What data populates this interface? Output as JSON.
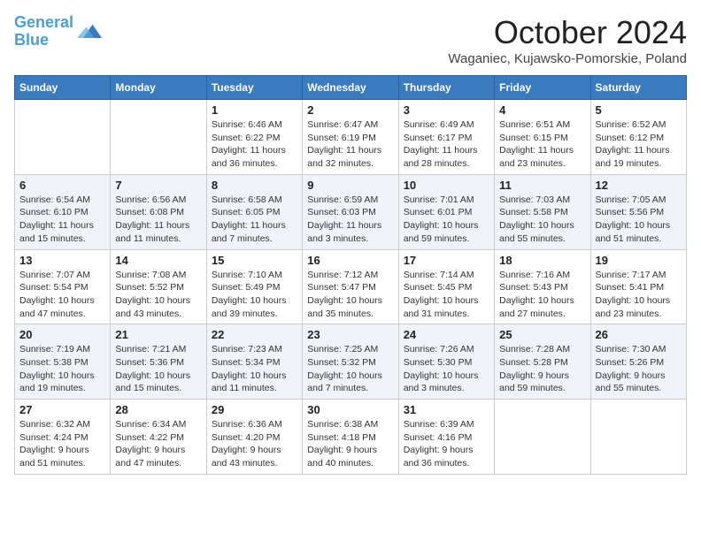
{
  "header": {
    "logo_line1": "General",
    "logo_line2": "Blue",
    "month_title": "October 2024",
    "location": "Waganiec, Kujawsko-Pomorskie, Poland"
  },
  "days_of_week": [
    "Sunday",
    "Monday",
    "Tuesday",
    "Wednesday",
    "Thursday",
    "Friday",
    "Saturday"
  ],
  "weeks": [
    [
      {
        "day": "",
        "info": ""
      },
      {
        "day": "",
        "info": ""
      },
      {
        "day": "1",
        "info": "Sunrise: 6:46 AM\nSunset: 6:22 PM\nDaylight: 11 hours and 36 minutes."
      },
      {
        "day": "2",
        "info": "Sunrise: 6:47 AM\nSunset: 6:19 PM\nDaylight: 11 hours and 32 minutes."
      },
      {
        "day": "3",
        "info": "Sunrise: 6:49 AM\nSunset: 6:17 PM\nDaylight: 11 hours and 28 minutes."
      },
      {
        "day": "4",
        "info": "Sunrise: 6:51 AM\nSunset: 6:15 PM\nDaylight: 11 hours and 23 minutes."
      },
      {
        "day": "5",
        "info": "Sunrise: 6:52 AM\nSunset: 6:12 PM\nDaylight: 11 hours and 19 minutes."
      }
    ],
    [
      {
        "day": "6",
        "info": "Sunrise: 6:54 AM\nSunset: 6:10 PM\nDaylight: 11 hours and 15 minutes."
      },
      {
        "day": "7",
        "info": "Sunrise: 6:56 AM\nSunset: 6:08 PM\nDaylight: 11 hours and 11 minutes."
      },
      {
        "day": "8",
        "info": "Sunrise: 6:58 AM\nSunset: 6:05 PM\nDaylight: 11 hours and 7 minutes."
      },
      {
        "day": "9",
        "info": "Sunrise: 6:59 AM\nSunset: 6:03 PM\nDaylight: 11 hours and 3 minutes."
      },
      {
        "day": "10",
        "info": "Sunrise: 7:01 AM\nSunset: 6:01 PM\nDaylight: 10 hours and 59 minutes."
      },
      {
        "day": "11",
        "info": "Sunrise: 7:03 AM\nSunset: 5:58 PM\nDaylight: 10 hours and 55 minutes."
      },
      {
        "day": "12",
        "info": "Sunrise: 7:05 AM\nSunset: 5:56 PM\nDaylight: 10 hours and 51 minutes."
      }
    ],
    [
      {
        "day": "13",
        "info": "Sunrise: 7:07 AM\nSunset: 5:54 PM\nDaylight: 10 hours and 47 minutes."
      },
      {
        "day": "14",
        "info": "Sunrise: 7:08 AM\nSunset: 5:52 PM\nDaylight: 10 hours and 43 minutes."
      },
      {
        "day": "15",
        "info": "Sunrise: 7:10 AM\nSunset: 5:49 PM\nDaylight: 10 hours and 39 minutes."
      },
      {
        "day": "16",
        "info": "Sunrise: 7:12 AM\nSunset: 5:47 PM\nDaylight: 10 hours and 35 minutes."
      },
      {
        "day": "17",
        "info": "Sunrise: 7:14 AM\nSunset: 5:45 PM\nDaylight: 10 hours and 31 minutes."
      },
      {
        "day": "18",
        "info": "Sunrise: 7:16 AM\nSunset: 5:43 PM\nDaylight: 10 hours and 27 minutes."
      },
      {
        "day": "19",
        "info": "Sunrise: 7:17 AM\nSunset: 5:41 PM\nDaylight: 10 hours and 23 minutes."
      }
    ],
    [
      {
        "day": "20",
        "info": "Sunrise: 7:19 AM\nSunset: 5:38 PM\nDaylight: 10 hours and 19 minutes."
      },
      {
        "day": "21",
        "info": "Sunrise: 7:21 AM\nSunset: 5:36 PM\nDaylight: 10 hours and 15 minutes."
      },
      {
        "day": "22",
        "info": "Sunrise: 7:23 AM\nSunset: 5:34 PM\nDaylight: 10 hours and 11 minutes."
      },
      {
        "day": "23",
        "info": "Sunrise: 7:25 AM\nSunset: 5:32 PM\nDaylight: 10 hours and 7 minutes."
      },
      {
        "day": "24",
        "info": "Sunrise: 7:26 AM\nSunset: 5:30 PM\nDaylight: 10 hours and 3 minutes."
      },
      {
        "day": "25",
        "info": "Sunrise: 7:28 AM\nSunset: 5:28 PM\nDaylight: 9 hours and 59 minutes."
      },
      {
        "day": "26",
        "info": "Sunrise: 7:30 AM\nSunset: 5:26 PM\nDaylight: 9 hours and 55 minutes."
      }
    ],
    [
      {
        "day": "27",
        "info": "Sunrise: 6:32 AM\nSunset: 4:24 PM\nDaylight: 9 hours and 51 minutes."
      },
      {
        "day": "28",
        "info": "Sunrise: 6:34 AM\nSunset: 4:22 PM\nDaylight: 9 hours and 47 minutes."
      },
      {
        "day": "29",
        "info": "Sunrise: 6:36 AM\nSunset: 4:20 PM\nDaylight: 9 hours and 43 minutes."
      },
      {
        "day": "30",
        "info": "Sunrise: 6:38 AM\nSunset: 4:18 PM\nDaylight: 9 hours and 40 minutes."
      },
      {
        "day": "31",
        "info": "Sunrise: 6:39 AM\nSunset: 4:16 PM\nDaylight: 9 hours and 36 minutes."
      },
      {
        "day": "",
        "info": ""
      },
      {
        "day": "",
        "info": ""
      }
    ]
  ]
}
